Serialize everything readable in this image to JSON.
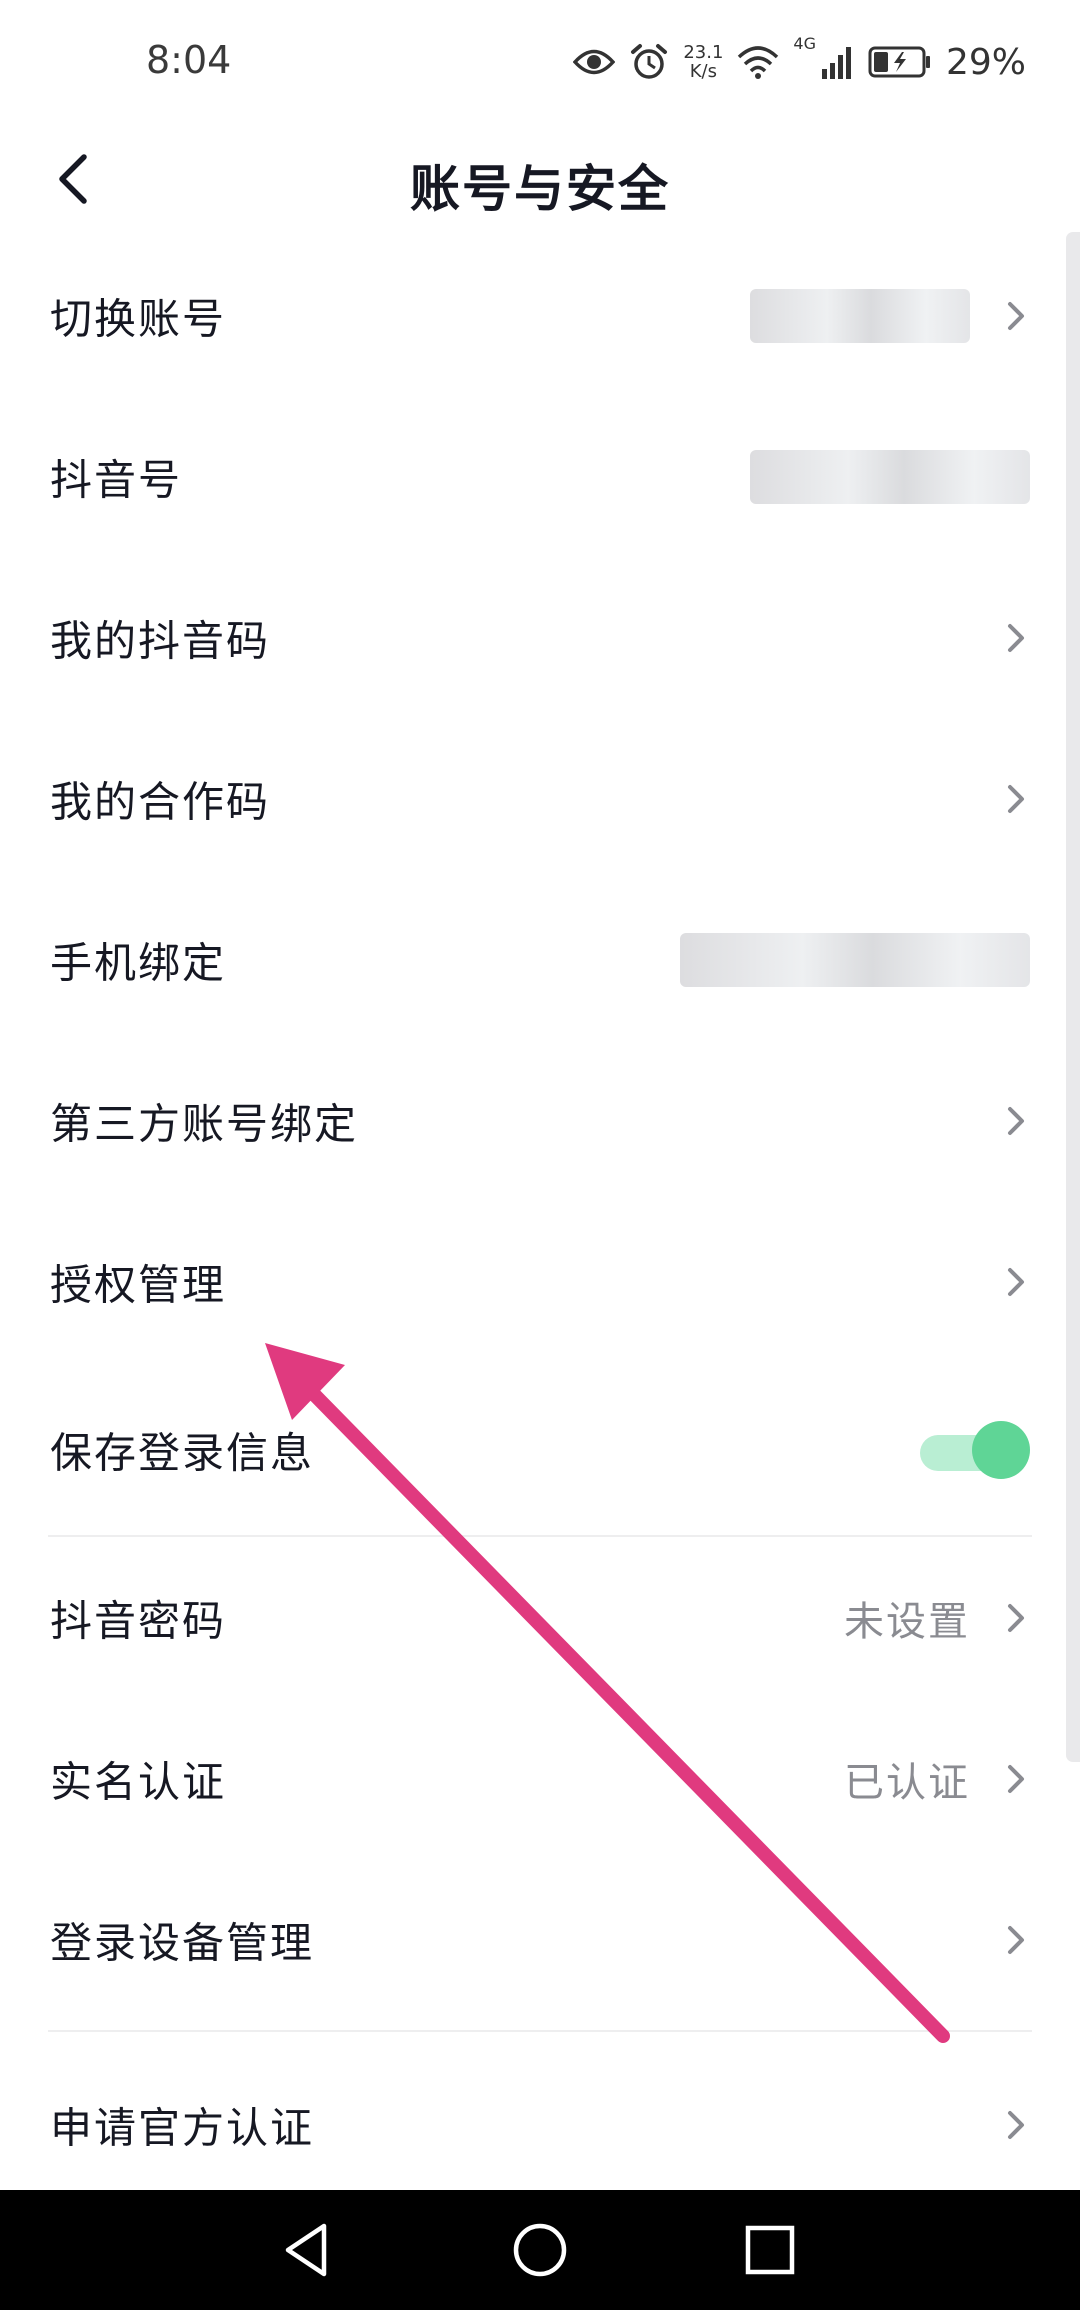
{
  "status_bar": {
    "time": "8:04",
    "net_speed_value": "23.1",
    "net_speed_unit": "K/s",
    "network_type": "4G",
    "battery_percent": "29%",
    "icons": [
      "eye-icon",
      "alarm-icon",
      "wifi-icon",
      "cellular-signal-icon",
      "battery-charging-icon"
    ]
  },
  "header": {
    "title": "账号与安全",
    "back_icon": "chevron-left-icon"
  },
  "settings": {
    "items": [
      {
        "label": "切换账号",
        "value": "",
        "blurred": true,
        "chevron": true
      },
      {
        "label": "抖音号",
        "value": "",
        "blurred": true,
        "chevron": false
      },
      {
        "label": "我的抖音码",
        "value": "",
        "chevron": true
      },
      {
        "label": "我的合作码",
        "value": "",
        "chevron": true
      },
      {
        "label": "手机绑定",
        "value": "",
        "blurred": true,
        "chevron": false
      },
      {
        "label": "第三方账号绑定",
        "value": "",
        "chevron": true
      },
      {
        "label": "授权管理",
        "value": "",
        "chevron": true
      },
      {
        "label": "保存登录信息",
        "toggle": true,
        "toggle_on": true
      },
      {
        "label": "抖音密码",
        "value": "未设置",
        "chevron": true
      },
      {
        "label": "实名认证",
        "value": "已认证",
        "chevron": true
      },
      {
        "label": "登录设备管理",
        "value": "",
        "chevron": true
      },
      {
        "label": "申请官方认证",
        "value": "",
        "chevron": true
      }
    ]
  },
  "colors": {
    "text_primary": "#161823",
    "text_secondary": "#8a8b91",
    "toggle_on": "#5fd596",
    "toggle_track": "#b9eed3",
    "annotation_arrow": "#e03a7f",
    "nav_bar": "#000000"
  },
  "nav_bar": {
    "buttons": [
      "back-triangle-icon",
      "home-circle-icon",
      "recents-square-icon"
    ]
  }
}
